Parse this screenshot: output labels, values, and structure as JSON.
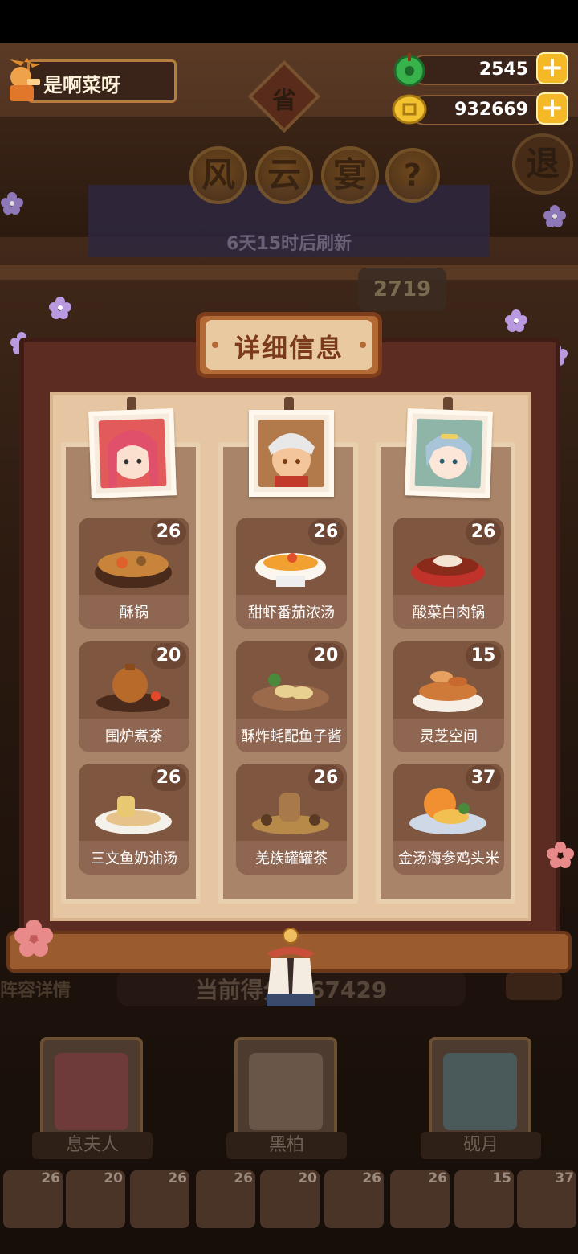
{
  "player": {
    "name": "是啊菜呀"
  },
  "currency": {
    "jade": "2545",
    "coins": "932669"
  },
  "banner": {
    "province_char": "省",
    "title_chars": [
      "风",
      "云",
      "宴"
    ],
    "help_char": "?",
    "exit_char": "退",
    "refresh_text": "6天15时后刷新",
    "bg_score": "2719"
  },
  "panel": {
    "title": "详细信息",
    "columns": [
      {
        "chef_color": "#e25a5a",
        "dishes": [
          {
            "name": "酥锅",
            "count": "26"
          },
          {
            "name": "围炉煮茶",
            "count": "20"
          },
          {
            "name": "三文鱼奶油汤",
            "count": "26"
          }
        ]
      },
      {
        "chef_color": "#b27a4a",
        "dishes": [
          {
            "name": "甜虾番茄浓汤",
            "count": "26"
          },
          {
            "name": "酥炸蚝配鱼子酱",
            "count": "20"
          },
          {
            "name": "羌族罐罐茶",
            "count": "26"
          }
        ]
      },
      {
        "chef_color": "#8fb4a8",
        "dishes": [
          {
            "name": "酸菜白肉锅",
            "count": "26"
          },
          {
            "name": "灵芝空间",
            "count": "15"
          },
          {
            "name": "金汤海参鸡头米",
            "count": "37"
          }
        ]
      }
    ]
  },
  "team": {
    "detail_label": "阵容详情",
    "score_text": "当前得分 267429",
    "chefs": [
      "息夫人",
      "黑柏",
      "砚月"
    ]
  },
  "dish_strip": [
    "26",
    "20",
    "26",
    "26",
    "20",
    "26",
    "26",
    "15",
    "37"
  ],
  "colors": {
    "accent": "#f5b928",
    "frame": "#5c2c22",
    "card": "#7f5640"
  }
}
